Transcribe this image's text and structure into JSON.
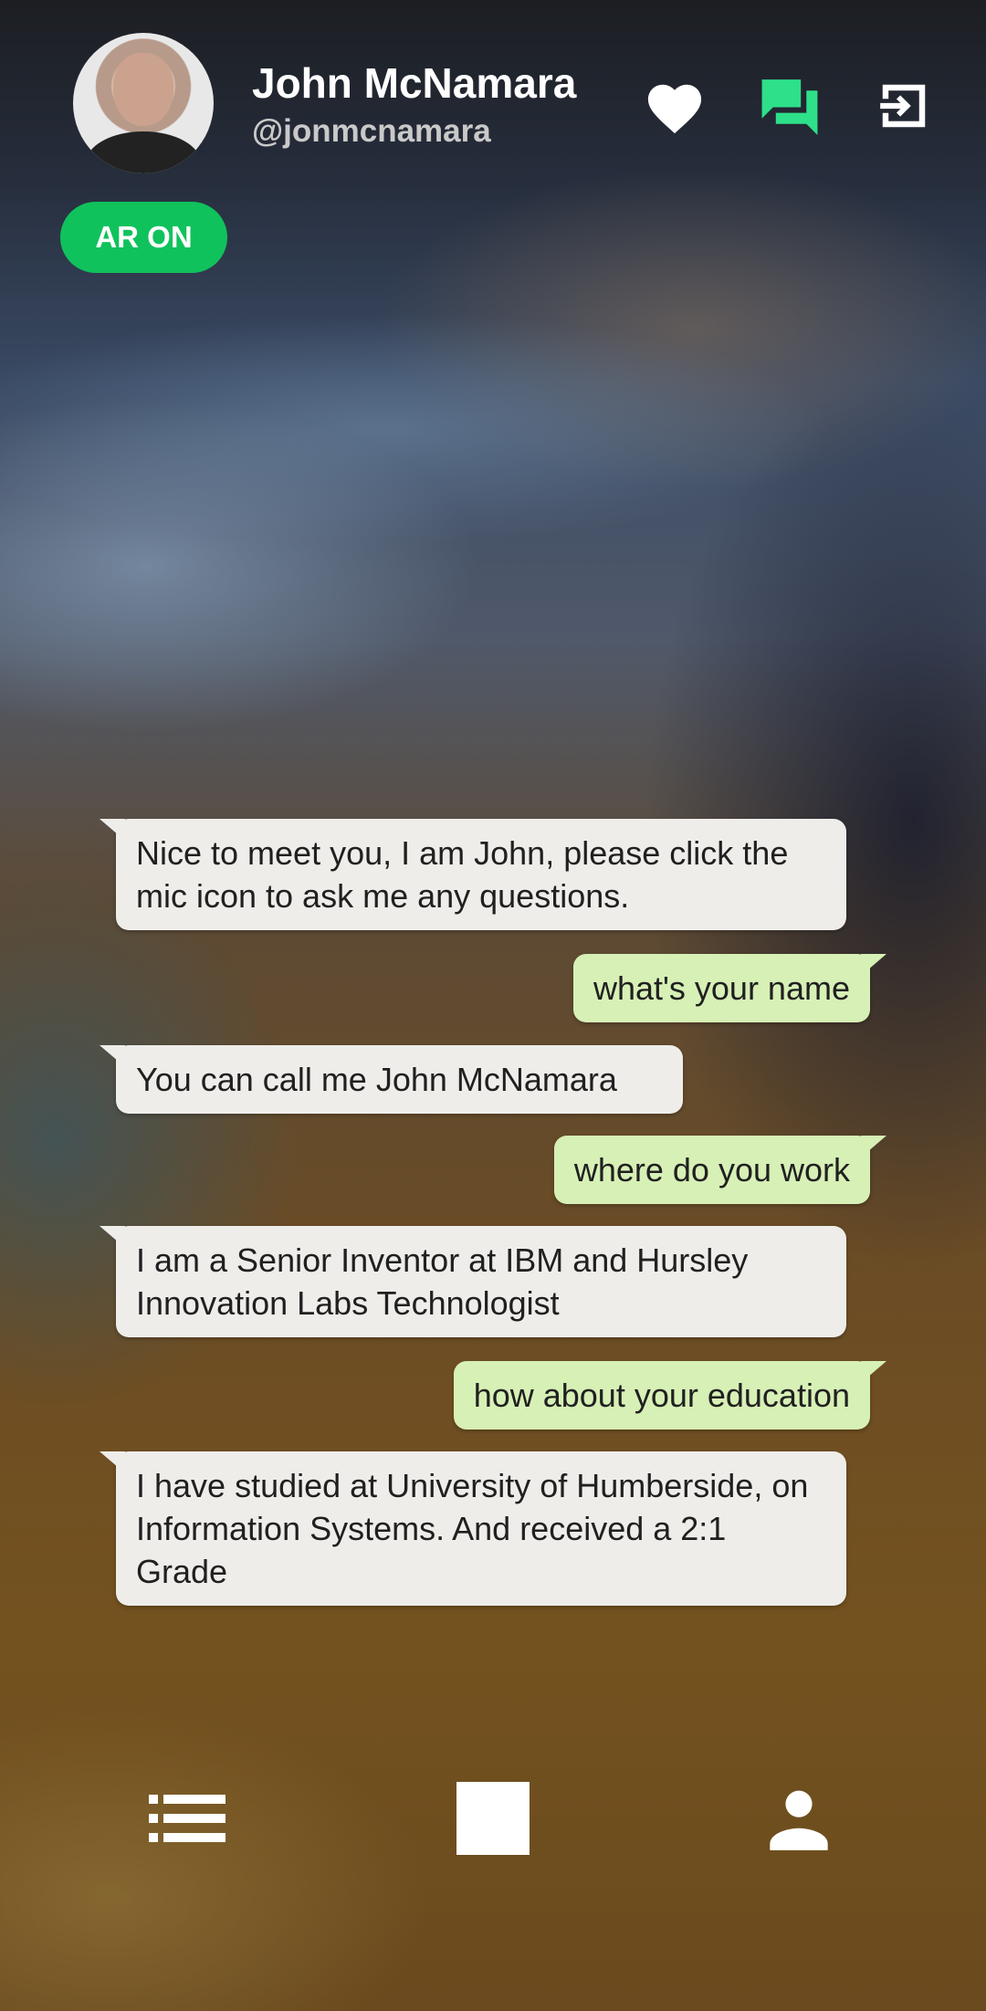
{
  "header": {
    "name": "John McNamara",
    "handle": "@jonmcnamara",
    "avatar_icon": "user-photo",
    "actions": [
      {
        "name": "heart-icon",
        "color": "#ffffff"
      },
      {
        "name": "chat-icon",
        "color": "#2ee08a"
      },
      {
        "name": "exit-icon",
        "color": "#ffffff"
      }
    ]
  },
  "ar_toggle": {
    "label": "AR ON",
    "color": "#10c25c"
  },
  "messages": [
    {
      "sender": "bot",
      "text": "Nice to meet you, I am John, please click the mic icon to ask me any questions."
    },
    {
      "sender": "user",
      "text": "what's your name"
    },
    {
      "sender": "bot",
      "text": "You can call me John McNamara"
    },
    {
      "sender": "user",
      "text": "where do you work"
    },
    {
      "sender": "bot",
      "text": "I am a Senior Inventor at IBM and Hursley Innovation Labs Technologist"
    },
    {
      "sender": "user",
      "text": "how about your education"
    },
    {
      "sender": "bot",
      "text": "I have studied at University of Humberside, on Information Systems. And received a 2:1 Grade"
    }
  ],
  "colors": {
    "bot_bubble": "#efedea",
    "user_bubble": "#d7f0b6",
    "text": "#202020"
  },
  "bottom_bar": {
    "items": [
      {
        "name": "list-icon"
      },
      {
        "name": "stop-icon"
      },
      {
        "name": "person-icon"
      }
    ]
  }
}
